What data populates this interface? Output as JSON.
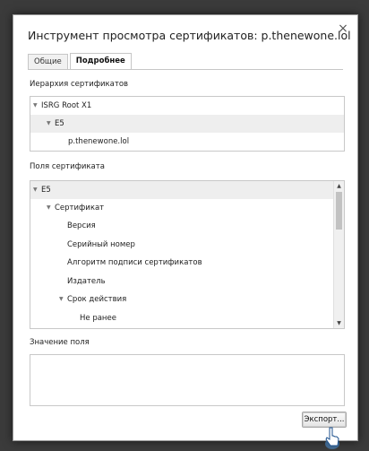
{
  "dialog": {
    "title": "Инструмент просмотра сертификатов: p.thenewone.lol",
    "close_glyph": "×"
  },
  "tabs": [
    {
      "label": "Общие"
    },
    {
      "label": "Подробнее"
    }
  ],
  "hierarchy": {
    "label": "Иерархия сертификатов",
    "items": [
      "ISRG Root X1",
      "E5",
      "p.thenewone.lol"
    ]
  },
  "fields": {
    "label": "Поля сертификата",
    "items": [
      "E5",
      "Сертификат",
      "Версия",
      "Серийный номер",
      "Алгоритм подписи сертификатов",
      "Издатель",
      "Срок действия",
      "Не ранее"
    ]
  },
  "field_value": {
    "label": "Значение поля",
    "value": ""
  },
  "buttons": {
    "export_label": "Экспорт..."
  },
  "icons": {
    "expand_glyph": "▼",
    "scroll_up_glyph": "▲",
    "scroll_down_glyph": "▼"
  }
}
